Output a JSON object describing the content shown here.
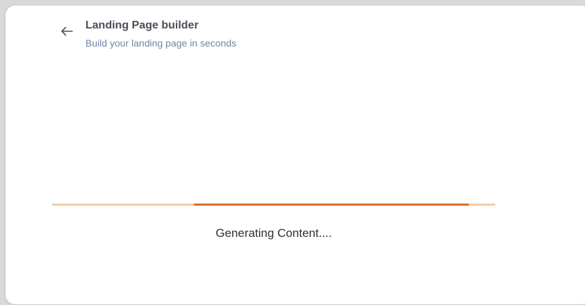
{
  "header": {
    "title": "Landing Page builder",
    "subtitle": "Build your landing page in seconds"
  },
  "status": {
    "text": "Generating Content...."
  },
  "progress": {
    "type": "indeterminate",
    "segment_start": 0.32,
    "segment_end": 0.94
  },
  "icons": {
    "back": "arrow-left-icon"
  },
  "colors": {
    "accent": "#d86b2e",
    "track": "#f6c9a0",
    "title": "#4a4f58",
    "subtitle": "#6f86a6",
    "status_text": "#2b2f36",
    "page_background": "#d9d9d9",
    "card_background": "#ffffff"
  }
}
